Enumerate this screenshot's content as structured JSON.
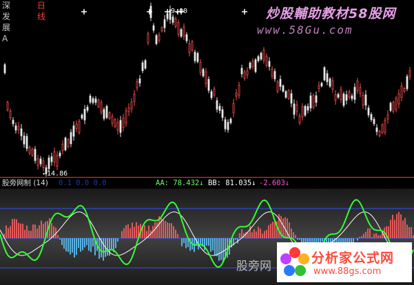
{
  "header": {
    "stock_name": "深发展A",
    "period": "日线"
  },
  "watermark": {
    "title": "炒股輔助教材58股网",
    "url": "www.58Gu.com"
  },
  "price_chart": {
    "high_label": "9.00",
    "low_label": "←14.86",
    "colors": {
      "up": "#ff5050",
      "down": "#e8e8e8",
      "background": "#000000"
    }
  },
  "indicator": {
    "name": "股旁网制 (14)",
    "blurred_values": "0.1  0.0  0.0",
    "aa": "AA: 78.432↓",
    "bb": "BB: 81.035↓",
    "neg": "-2.603↓",
    "colors": {
      "line1": "#33ff33",
      "line2": "#ffffff",
      "pos_bar": "#ff6060",
      "neg_bar": "#60c8ff",
      "ref_line": "#3050ff"
    }
  },
  "logo": {
    "text": "分析家公式网",
    "url": "www.88gs.com",
    "ghost_text": "股旁网"
  }
}
